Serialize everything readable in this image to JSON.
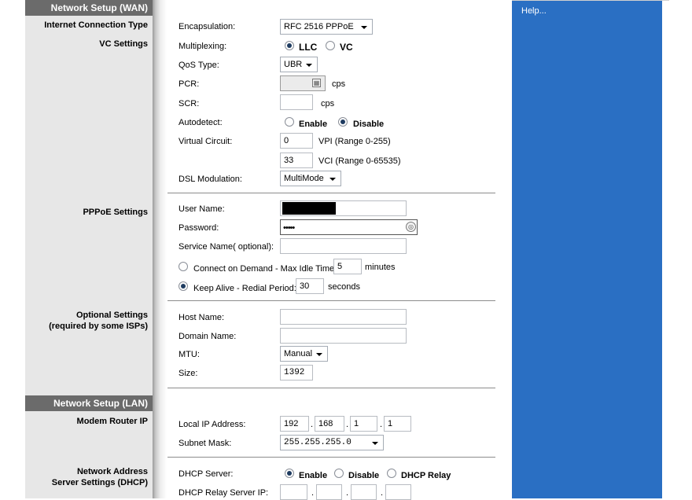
{
  "help": {
    "label": "Help..."
  },
  "wan": {
    "header": "Network Setup (WAN)",
    "internet_connection_type": {
      "section_label": "Internet Connection Type",
      "encapsulation_label": "Encapsulation:",
      "encapsulation_value": "RFC 2516 PPPoE"
    },
    "vc": {
      "section_label": "VC Settings",
      "multiplexing_label": "Multiplexing:",
      "multiplexing_options": [
        "LLC",
        "VC"
      ],
      "multiplexing_selected": "LLC",
      "qos_label": "QoS Type:",
      "qos_value": "UBR",
      "pcr_label": "PCR:",
      "pcr_unit": "cps",
      "scr_label": "SCR:",
      "scr_unit": "cps",
      "autodetect_label": "Autodetect:",
      "autodetect_options": [
        "Enable",
        "Disable"
      ],
      "autodetect_selected": "Disable",
      "vc_label": "Virtual Circuit:",
      "vpi_value": "0",
      "vpi_hint": "VPI (Range 0-255)",
      "vci_value": "33",
      "vci_hint": "VCI (Range 0-65535)",
      "dsl_label": "DSL Modulation:",
      "dsl_value": "MultiMode"
    },
    "pppoe": {
      "section_label": "PPPoE Settings",
      "username_label": "User Name:",
      "password_label": "Password:",
      "password_value": "•••••",
      "service_label": "Service Name( optional):",
      "cod_label": "Connect on Demand - Max Idle Time:",
      "cod_value": "5",
      "cod_unit": "minutes",
      "keepalive_label": "Keep Alive - Redial Period:",
      "keepalive_value": "30",
      "keepalive_unit": "seconds",
      "selected_mode": "Keep Alive"
    },
    "optional": {
      "section_label_1": "Optional Settings",
      "section_label_2": "(required by some ISPs)",
      "host_label": "Host Name:",
      "domain_label": "Domain Name:",
      "mtu_label": "MTU:",
      "mtu_value": "Manual",
      "size_label": "Size:",
      "size_value": "1392"
    }
  },
  "lan": {
    "header": "Network Setup (LAN)",
    "modem_router_ip": {
      "section_label": "Modem Router IP",
      "local_ip_label": "Local IP Address:",
      "ip_octets": [
        "192",
        "168",
        "1",
        "1"
      ],
      "subnet_label": "Subnet Mask:",
      "subnet_value": "255.255.255.0"
    },
    "dhcp": {
      "section_label_1": "Network Address",
      "section_label_2": "Server Settings (DHCP)",
      "dhcp_server_label": "DHCP Server:",
      "dhcp_options": [
        "Enable",
        "Disable",
        "DHCP Relay"
      ],
      "dhcp_selected": "Enable",
      "relay_ip_label": "DHCP Relay Server IP:",
      "dot": "."
    }
  },
  "colors": {
    "help_panel": "#2a6fc3",
    "section_bar": "#6b6b6b",
    "left_column": "#e7e7e7"
  }
}
